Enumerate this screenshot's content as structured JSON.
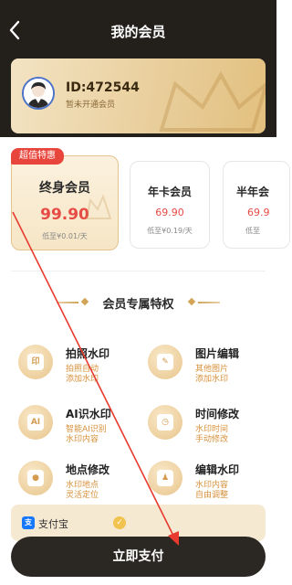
{
  "header": {
    "title": "我的会员"
  },
  "member": {
    "id": "ID:472544",
    "status": "暂未开通会员"
  },
  "plans": [
    {
      "badge": "超值特惠",
      "name": "终身会员",
      "price": "99.90",
      "sub": "低至¥0.01/天"
    },
    {
      "name": "年卡会员",
      "price": "69.90",
      "sub": "低至¥0.19/天"
    },
    {
      "name": "半年会",
      "price": "69.9",
      "sub": "低至"
    }
  ],
  "section": {
    "title": "会员专属特权"
  },
  "features": [
    {
      "title": "拍照水印",
      "desc1": "拍照自动",
      "desc2": "添加水印",
      "icon": "印"
    },
    {
      "title": "图片编辑",
      "desc1": "其他图片",
      "desc2": "添加水印",
      "icon": "✎"
    },
    {
      "title": "AI识水印",
      "desc1": "智能AI识别",
      "desc2": "水印内容",
      "icon": "AI"
    },
    {
      "title": "时间修改",
      "desc1": "水印时间",
      "desc2": "手动修改",
      "icon": "◷"
    },
    {
      "title": "地点修改",
      "desc1": "水印地点",
      "desc2": "灵活定位",
      "icon": "●"
    },
    {
      "title": "编辑水印",
      "desc1": "水印内容",
      "desc2": "自由调整",
      "icon": "♟"
    }
  ],
  "payment": {
    "method": "支付宝",
    "alipay_glyph": "支",
    "check_glyph": "✓"
  },
  "cta": {
    "label": "立即支付"
  },
  "colors": {
    "accent_red": "#e64b45",
    "gold": "#d2a456",
    "dark": "#23201c"
  }
}
